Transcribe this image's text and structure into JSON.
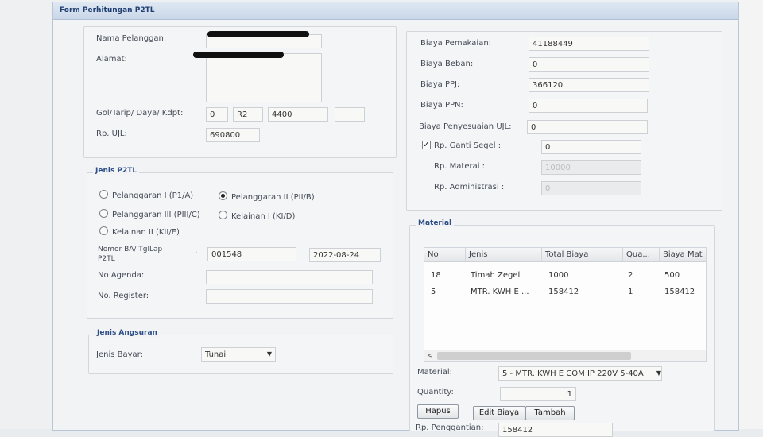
{
  "window": {
    "title": "Form Perhitungan P2TL"
  },
  "customer": {
    "nama_label": "Nama Pelanggan:",
    "alamat_label": "Alamat:",
    "gol_label": "Gol/Tarip/ Daya/ Kdpt:",
    "gol_values": [
      "0",
      "R2",
      "4400",
      ""
    ],
    "ujl_label": "Rp. UJL:",
    "ujl_value": "690800"
  },
  "costs": {
    "pemakaian_label": "Biaya Pemakaian:",
    "pemakaian_value": "41188449",
    "beban_label": "Biaya Beban:",
    "beban_value": "0",
    "ppj_label": "Biaya PPJ:",
    "ppj_value": "366120",
    "ppn_label": "Biaya PPN:",
    "ppn_value": "0",
    "penyesuaian_label": "Biaya Penyesuaian UJL:",
    "penyesuaian_value": "0",
    "ganti_segel_label": "Rp. Ganti Segel :",
    "ganti_segel_checked": true,
    "ganti_segel_value": "0",
    "materai_label": "Rp. Materai :",
    "materai_value": "10000",
    "administrasi_label": "Rp. Administrasi :",
    "administrasi_value": "0"
  },
  "jenis_p2tl": {
    "legend": "Jenis P2TL",
    "options": [
      {
        "label": "Pelanggaran I (P1/A)",
        "selected": false
      },
      {
        "label": "Pelanggaran II (PII/B)",
        "selected": true
      },
      {
        "label": "Pelanggaran III (PIII/C)",
        "selected": false
      },
      {
        "label": "Kelainan I (KI/D)",
        "selected": false
      },
      {
        "label": "Kelainan II (KII/E)",
        "selected": false
      }
    ],
    "nomor_label": "Nomor BA/ TglLap",
    "nomor_label2": "P2TL",
    "nomor_sep": ":",
    "nomor_value": "001548",
    "tgl_value": "2022-08-24",
    "agenda_label": "No Agenda:",
    "agenda_value": "",
    "register_label": "No. Register:",
    "register_value": ""
  },
  "angsuran": {
    "legend": "Jenis Angsuran",
    "bayar_label": "Jenis Bayar:",
    "bayar_value": "Tunai"
  },
  "material": {
    "legend": "Material",
    "columns": [
      "No",
      "Jenis",
      "Total Biaya",
      "Qua...",
      "Biaya Mat"
    ],
    "rows": [
      [
        "18",
        "Timah Zegel",
        "1000",
        "2",
        "500"
      ],
      [
        "5",
        "MTR. KWH E ...",
        "158412",
        "1",
        "158412"
      ]
    ],
    "material_label": "Material:",
    "material_value": "5 - MTR. KWH E COM IP 220V 5-40A",
    "quantity_label": "Quantity:",
    "quantity_value": "1",
    "hapus_label": "Hapus",
    "edit_label": "Edit Biaya",
    "tambah_label": "Tambah",
    "penggantian_label": "Rp. Penggantian:",
    "penggantian_value": "158412"
  },
  "colors": {
    "title_bar": "#c9d7e8",
    "legend_text": "#2d4d86",
    "panel_bg": "#f3f5f7"
  }
}
